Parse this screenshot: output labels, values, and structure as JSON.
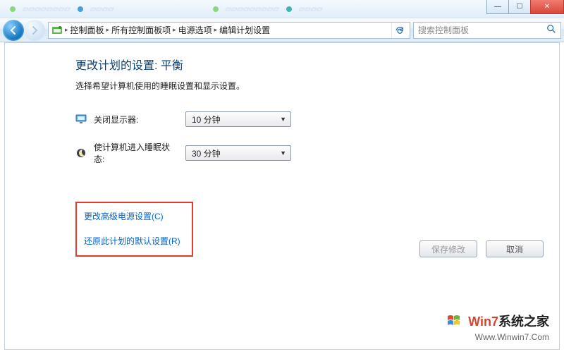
{
  "window_controls": {
    "minimize": "—",
    "maximize": "☐",
    "close": "✕"
  },
  "breadcrumb": {
    "items": [
      "控制面板",
      "所有控制面板项",
      "电源选项",
      "编辑计划设置"
    ]
  },
  "search": {
    "placeholder": "搜索控制面板"
  },
  "page": {
    "title": "更改计划的设置: 平衡",
    "subtitle": "选择希望计算机使用的睡眠设置和显示设置。"
  },
  "settings": {
    "display_off": {
      "label": "关闭显示器:",
      "value": "10 分钟"
    },
    "sleep": {
      "label": "使计算机进入睡眠状态:",
      "value": "30 分钟"
    }
  },
  "links": {
    "advanced": "更改高级电源设置(C)",
    "restore": "还原此计划的默认设置(R)"
  },
  "buttons": {
    "save": "保存修改",
    "cancel": "取消"
  },
  "watermark": {
    "brand_prefix": "Win7",
    "brand_suffix": "系统之家",
    "url": "Www.Winwin7.Com"
  }
}
